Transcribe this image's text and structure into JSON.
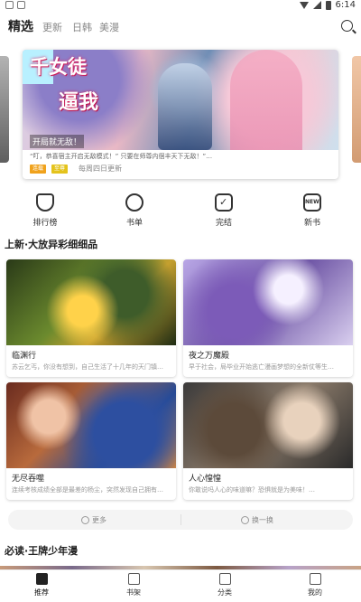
{
  "status_bar": {
    "time": "6:14"
  },
  "nav": {
    "tabs": [
      {
        "label": "精选",
        "active": true
      },
      {
        "label": "更新",
        "active": false
      },
      {
        "label": "日韩",
        "active": false
      },
      {
        "label": "美漫",
        "active": false
      }
    ]
  },
  "banner": {
    "art_title_1": "千女徒",
    "art_title_2": "逼我",
    "caption": "开局就无敌！",
    "description": "“叮，恭喜宿主开启无敌模式！” 只要在师尊内徊丰天下无敌！”…",
    "badge_1": "连载",
    "badge_2": "至尊",
    "update": "每周四日更新"
  },
  "quick_entries": [
    {
      "label": "排行榜",
      "icon": "trophy-icon"
    },
    {
      "label": "书单",
      "icon": "book-list-icon"
    },
    {
      "label": "完结",
      "icon": "finished-icon"
    },
    {
      "label": "新书",
      "icon": "new-book-icon"
    }
  ],
  "section_1": {
    "title": "上新·大放异彩细细品"
  },
  "cards": [
    {
      "title": "临渊行",
      "desc": "苏云乞丐，你没有想到，自己生活了十几年的天门镇…"
    },
    {
      "title": "夜之万魔殿",
      "desc": "早于社会，局毕业开始逃亡漫画梦想的全新仗等生…"
    },
    {
      "title": "无尽吞噬",
      "desc": "连续考核成绩全部是最差的杨尘，突然发现自己拥有…"
    },
    {
      "title": "人心惶惶",
      "desc": "你敢说吗人心的味道嘛？恐惧就是为美味！…"
    }
  ],
  "more_row": {
    "more_label": "更多",
    "refresh_label": "换一换"
  },
  "section_2": {
    "title": "必读·王牌少年漫"
  },
  "tabbar": {
    "items": [
      {
        "label": "推荐",
        "active": true
      },
      {
        "label": "书架",
        "active": false
      },
      {
        "label": "分类",
        "active": false
      },
      {
        "label": "我的",
        "active": false
      }
    ]
  }
}
